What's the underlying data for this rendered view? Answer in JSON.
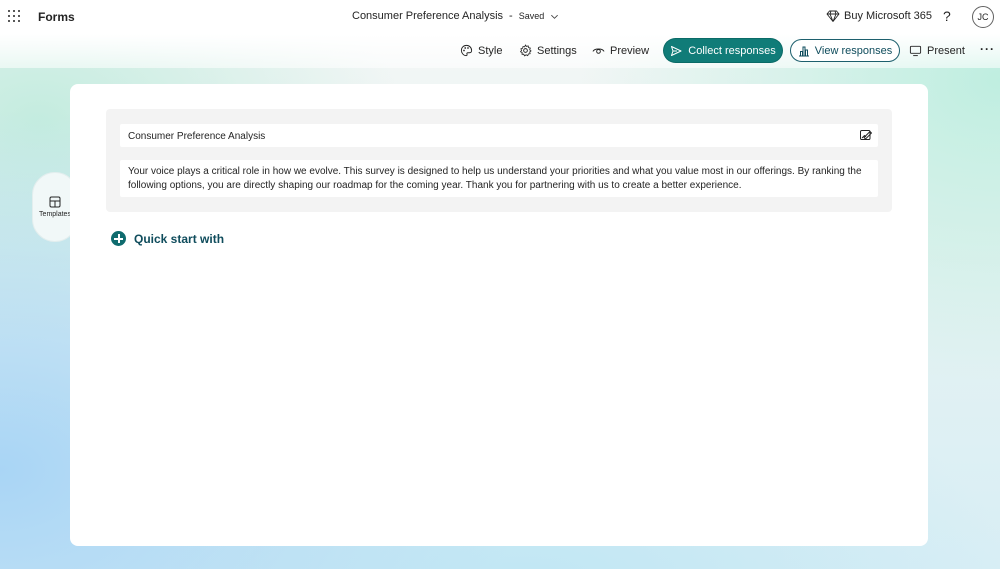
{
  "app": {
    "name": "Forms"
  },
  "document": {
    "title": "Consumer Preference Analysis",
    "separator": "-",
    "status": "Saved"
  },
  "header_right": {
    "buy_label": "Buy Microsoft 365",
    "help_label": "?",
    "avatar_initials": "JC"
  },
  "toolbar": {
    "style_label": "Style",
    "settings_label": "Settings",
    "preview_label": "Preview",
    "collect_label": "Collect responses",
    "view_label": "View responses",
    "present_label": "Present",
    "more_label": "···"
  },
  "side": {
    "templates_label": "Templates"
  },
  "form": {
    "title": "Consumer Preference Analysis",
    "description": "Your voice plays a critical role in how we evolve. This survey is designed to help us understand your priorities and what you value most in our offerings. By ranking the following options, you are directly shaping our roadmap for the coming year. Thank you for partnering with us to create a better experience.",
    "quick_start_label": "Quick start with"
  },
  "colors": {
    "accent": "#107c78",
    "accent_dark": "#0f4c5c"
  }
}
